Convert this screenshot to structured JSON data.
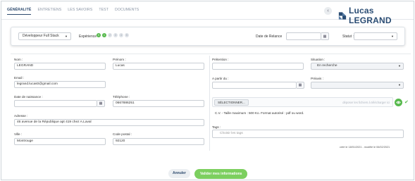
{
  "tabs": [
    {
      "label": "GÉNÉRALITÉ",
      "active": true
    },
    {
      "label": "ENTRETIENS",
      "active": false
    },
    {
      "label": "LES SAVOIRS",
      "active": false
    },
    {
      "label": "TEST",
      "active": false
    },
    {
      "label": "DOCUMENTS",
      "active": false
    }
  ],
  "header": {
    "back_icon": "chevron-left-icon",
    "back_glyph": "‹",
    "candidate_name": "Lucas LEGRAND",
    "logo_color": "#2b4d74"
  },
  "top_bar": {
    "profile_select": "Développeur Full Stack",
    "experience_label": "Expérience",
    "experience_levels": [
      "0",
      "1",
      "2",
      "3",
      "4",
      "5"
    ],
    "experience_selected": 1,
    "relance_label": "Date de Relance",
    "relance_value": "",
    "statut_label": "Statut :",
    "statut_value": ""
  },
  "form": {
    "nom_label": "Nom :",
    "nom_value": "LEGRAND",
    "prenom_label": "Prénom :",
    "prenom_value": "Lucas",
    "email_label": "Email :",
    "email_value": "legrand.lucas0@gmail.com",
    "naissance_label": "Date de naissance :",
    "naissance_value": "",
    "telephone_label": "Téléphone :",
    "telephone_value": "0667886251",
    "adresse_label": "Adresse :",
    "adresse_value": "46 avenue de la République apt 419 chez A.Laval",
    "ville_label": "Ville :",
    "ville_value": "Montrouge",
    "cp_label": "Code postal :",
    "cp_value": "92120",
    "pretention_label": "Prétention :",
    "pretention_value": "",
    "situation_label": "Situation :",
    "situation_value": "En recherche",
    "apartir_label": "A partir du :",
    "apartir_value": "",
    "preavis_label": "Préavis :",
    "preavis_value": "",
    "upload_button": "SÉLECTIONNER...",
    "upload_hint": "déposer les fichiers à télécharger ici",
    "file_note": "C.V. - Taille maximum : 500 Ko. Format autorisé : pdf ou word.",
    "tags_label": "Tags :",
    "tags_placeholder": "Choisir les tags",
    "meta": "créé le 18/01/2021 - modifié le 06/02/2021"
  },
  "footer": {
    "cancel_label": "Annuler",
    "validate_label": "Valider mes informations"
  },
  "colors": {
    "accent_green": "#57b94d",
    "validate_green": "#7ccf5f",
    "brand_blue": "#2b4d74"
  }
}
